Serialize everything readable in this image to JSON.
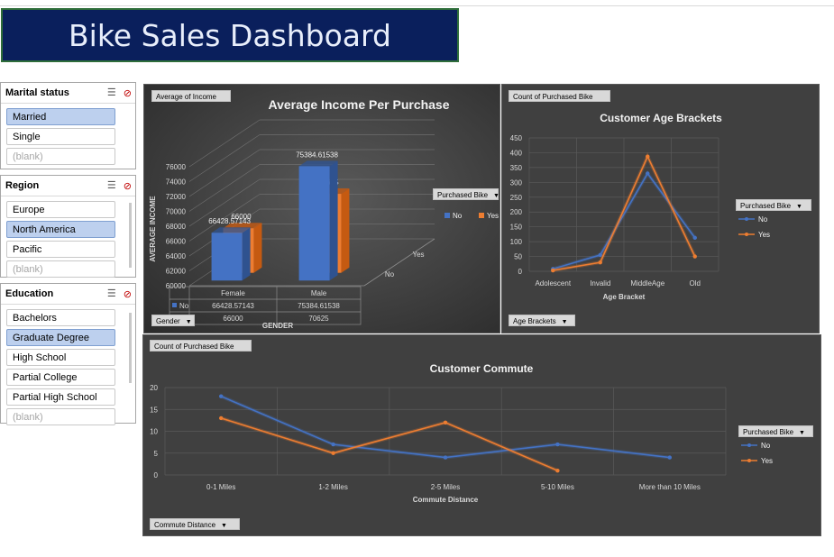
{
  "dashboard": {
    "title": "Bike Sales Dashboard"
  },
  "slicers": {
    "marital": {
      "label": "Marital status",
      "items": [
        {
          "text": "Married",
          "selected": true
        },
        {
          "text": "Single",
          "selected": false
        },
        {
          "text": "(blank)",
          "selected": false
        }
      ]
    },
    "region": {
      "label": "Region",
      "items": [
        {
          "text": "Europe",
          "selected": false
        },
        {
          "text": "North America",
          "selected": true
        },
        {
          "text": "Pacific",
          "selected": false
        },
        {
          "text": "(blank)",
          "selected": false
        }
      ]
    },
    "education": {
      "label": "Education",
      "items": [
        {
          "text": "Bachelors",
          "selected": false
        },
        {
          "text": "Graduate Degree",
          "selected": true
        },
        {
          "text": "High School",
          "selected": false
        },
        {
          "text": "Partial College",
          "selected": false
        },
        {
          "text": "Partial High School",
          "selected": false
        },
        {
          "text": "(blank)",
          "selected": false
        }
      ]
    }
  },
  "colors": {
    "no": "#4472c4",
    "yes": "#ed7d31",
    "title_bg": "#0a1f5c",
    "panel_bg": "#404040"
  },
  "chart_data": [
    {
      "type": "bar",
      "field_button": "Average of Income",
      "title": "Average Income Per  Purchase",
      "xlabel": "GENDER",
      "ylabel": "AVERAGE INCOME",
      "categories": [
        "Female",
        "Male"
      ],
      "series": [
        {
          "name": "No",
          "values": [
            66428.57143,
            75384.61538
          ]
        },
        {
          "name": "Yes",
          "values": [
            66000,
            70625
          ]
        }
      ],
      "data_labels": {
        "No": [
          "66428.57143",
          "75384.61538"
        ],
        "Yes": [
          "66000",
          "70625"
        ]
      },
      "yticks": [
        "60000",
        "62000",
        "64000",
        "66000",
        "68000",
        "70000",
        "72000",
        "74000",
        "76000"
      ],
      "ylim": [
        60000,
        76000
      ],
      "depth_labels": [
        "No",
        "Yes"
      ],
      "legend_title": "Purchased Bike",
      "legend": [
        "No",
        "Yes"
      ],
      "axis_field_button": "Gender",
      "table": {
        "headers": [
          "Female",
          "Male"
        ],
        "rows": [
          {
            "name": "No",
            "values": [
              "66428.57143",
              "75384.61538"
            ]
          },
          {
            "name": "Yes",
            "values": [
              "66000",
              "70625"
            ]
          }
        ]
      }
    },
    {
      "type": "line",
      "field_button": "Count of Purchased Bike",
      "title": "Customer Age Brackets",
      "xlabel": "Age Bracket",
      "categories": [
        "Adolescent",
        "Invalid",
        "MiddleAge",
        "Old"
      ],
      "series": [
        {
          "name": "No",
          "values": [
            8,
            55,
            330,
            113
          ]
        },
        {
          "name": "Yes",
          "values": [
            3,
            30,
            387,
            50
          ]
        }
      ],
      "yticks": [
        "0",
        "50",
        "100",
        "150",
        "200",
        "250",
        "300",
        "350",
        "400",
        "450"
      ],
      "ylim": [
        0,
        450
      ],
      "legend_title": "Purchased Bike",
      "legend": [
        "No",
        "Yes"
      ],
      "axis_field_button": "Age Brackets"
    },
    {
      "type": "line",
      "field_button": "Count of Purchased Bike",
      "title": "Customer Commute",
      "xlabel": "Commute Distance",
      "categories": [
        "0-1 Miles",
        "1-2 Miles",
        "2-5 Miles",
        "5-10 Miles",
        "More than 10 Miles"
      ],
      "series": [
        {
          "name": "No",
          "values": [
            18,
            7,
            4,
            7,
            4
          ]
        },
        {
          "name": "Yes",
          "values": [
            13,
            5,
            12,
            1,
            null
          ]
        }
      ],
      "yticks": [
        "0",
        "5",
        "10",
        "15",
        "20"
      ],
      "ylim": [
        0,
        20
      ],
      "legend_title": "Purchased Bike",
      "legend": [
        "No",
        "Yes"
      ],
      "axis_field_button": "Commute Distance"
    }
  ]
}
